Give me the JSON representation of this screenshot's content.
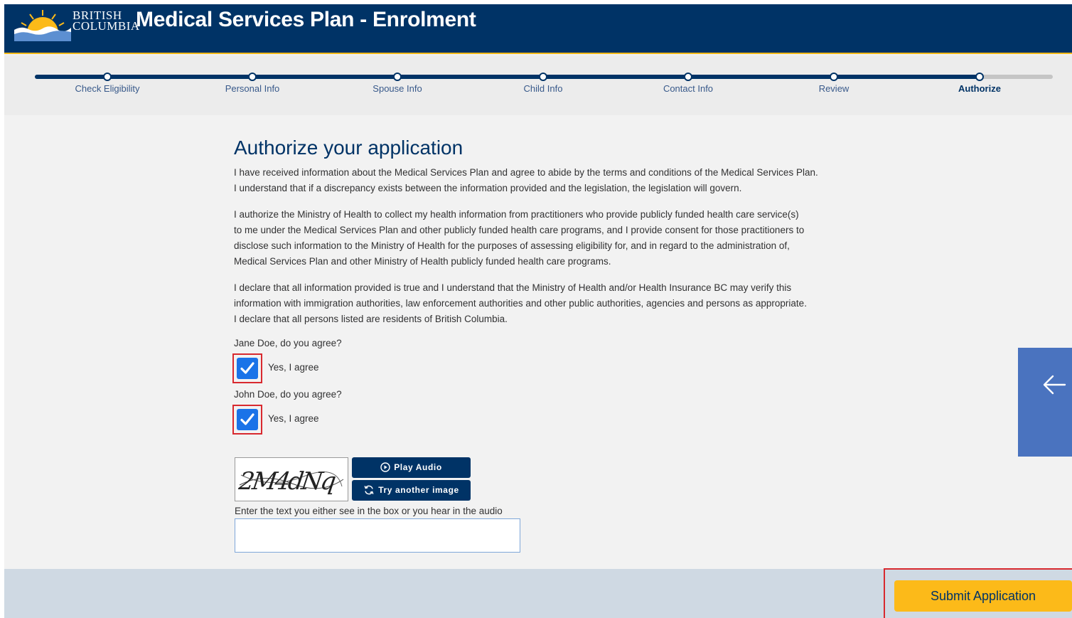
{
  "header": {
    "logo_line1": "BRITISH",
    "logo_line2": "COLUMBIA",
    "title": "Medical Services Plan - Enrolment"
  },
  "progress": {
    "steps": [
      {
        "label": "Check Eligibility"
      },
      {
        "label": "Personal Info"
      },
      {
        "label": "Spouse Info"
      },
      {
        "label": "Child Info"
      },
      {
        "label": "Contact Info"
      },
      {
        "label": "Review"
      },
      {
        "label": "Authorize"
      }
    ],
    "active_step": "Authorize"
  },
  "main": {
    "title": "Authorize your application",
    "paragraph1": {
      "line1": "I have received information about the Medical Services Plan and agree to abide by the terms and conditions of the Medical Services Plan.",
      "line2": "I understand that if a discrepancy exists between the information provided and the legislation, the legislation will govern."
    },
    "paragraph2": {
      "line1": "I authorize the Ministry of Health to collect my health information from practitioners who provide publicly funded health care service(s)",
      "line2": "to me under the Medical Services Plan and other publicly funded health care programs, and I provide consent for those practitioners to",
      "line3": "disclose such information to the Ministry of Health for the purposes of assessing eligibility for, and in regard to the administration of,",
      "line4": "Medical Services Plan and other Ministry of Health publicly funded health care programs."
    },
    "paragraph3": {
      "line1": "I declare that all information provided is true and I understand that the Ministry of Health and/or Health Insurance BC may verify this",
      "line2": "information with immigration authorities, law enforcement authorities and other public authorities, agencies and persons as appropriate.",
      "line3": "I declare that all persons listed are residents of British Columbia."
    },
    "agreements": [
      {
        "question": "Jane Doe, do you agree?",
        "label": "Yes, I agree",
        "checked": true
      },
      {
        "question": "John Doe, do you agree?",
        "label": "Yes, I agree",
        "checked": true
      }
    ],
    "captcha": {
      "image_text": "2M4dNq",
      "play_audio_label": "Play Audio",
      "try_another_label": "Try another image",
      "help_text": "Enter the text you either see in the box or you hear in the audio",
      "input_value": ""
    }
  },
  "footer": {
    "submit_label": "Submit Application"
  },
  "colors": {
    "header_bg": "#003366",
    "accent_gold": "#fcba19",
    "checkbox_blue": "#1a73e8",
    "highlight_red": "#d8292f",
    "side_tab": "#4a73bf"
  },
  "icons": {
    "side_tab": "arrow-left-icon",
    "play": "play-circle-icon",
    "retry": "refresh-icon",
    "check": "checkmark-icon"
  }
}
